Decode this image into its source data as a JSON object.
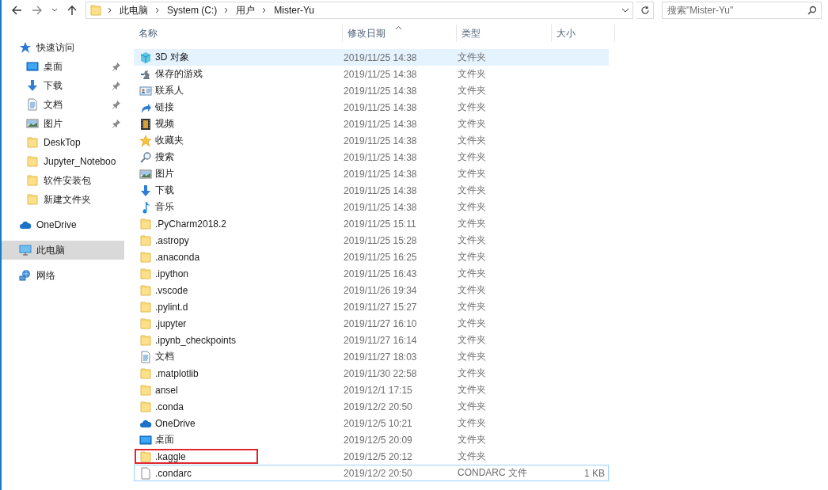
{
  "address": {
    "crumbs": [
      "此电脑",
      "System (C:)",
      "用户",
      "Mister-Yu"
    ]
  },
  "search": {
    "placeholder": "搜索\"Mister-Yu\""
  },
  "sidebar": {
    "items": [
      {
        "label": "快速访问",
        "kind": "star",
        "selected": false,
        "children": [
          {
            "label": "桌面",
            "kind": "desktop",
            "pinned": true,
            "selected": false
          },
          {
            "label": "下载",
            "kind": "downloads",
            "pinned": true,
            "selected": false
          },
          {
            "label": "文档",
            "kind": "document",
            "pinned": true,
            "selected": false
          },
          {
            "label": "图片",
            "kind": "pictures",
            "pinned": true,
            "selected": false
          },
          {
            "label": "DeskTop",
            "kind": "folder",
            "pinned": false,
            "selected": false
          },
          {
            "label": "Jupyter_Noteboo",
            "kind": "folder",
            "pinned": false,
            "selected": false
          },
          {
            "label": "软件安装包",
            "kind": "folder",
            "pinned": false,
            "selected": false
          },
          {
            "label": "新建文件夹",
            "kind": "folder",
            "pinned": false,
            "selected": false
          }
        ]
      },
      {
        "label": "OneDrive",
        "kind": "onedrive",
        "selected": false
      },
      {
        "label": "此电脑",
        "kind": "pc",
        "selected": true
      },
      {
        "label": "网络",
        "kind": "network",
        "selected": false
      }
    ]
  },
  "table": {
    "columns": [
      {
        "label": "名称",
        "sorted": false
      },
      {
        "label": "修改日期",
        "sorted": true
      },
      {
        "label": "类型",
        "sorted": false
      },
      {
        "label": "大小",
        "sorted": false
      }
    ],
    "rows": [
      {
        "name": "3D 对象",
        "date": "2019/11/25 14:38",
        "type": "文件夹",
        "kind": "cube",
        "hovered": true,
        "focused": false,
        "highlighted": false
      },
      {
        "name": "保存的游戏",
        "date": "2019/11/25 14:38",
        "type": "文件夹",
        "kind": "games",
        "hovered": false,
        "focused": false,
        "highlighted": false
      },
      {
        "name": "联系人",
        "date": "2019/11/25 14:38",
        "type": "文件夹",
        "kind": "contacts",
        "hovered": false,
        "focused": false,
        "highlighted": false
      },
      {
        "name": "链接",
        "date": "2019/11/25 14:38",
        "type": "文件夹",
        "kind": "link",
        "hovered": false,
        "focused": false,
        "highlighted": false
      },
      {
        "name": "视频",
        "date": "2019/11/25 14:38",
        "type": "文件夹",
        "kind": "video",
        "hovered": false,
        "focused": false,
        "highlighted": false
      },
      {
        "name": "收藏夹",
        "date": "2019/11/25 14:38",
        "type": "文件夹",
        "kind": "favorites",
        "hovered": false,
        "focused": false,
        "highlighted": false
      },
      {
        "name": "搜索",
        "date": "2019/11/25 14:38",
        "type": "文件夹",
        "kind": "search",
        "hovered": false,
        "focused": false,
        "highlighted": false
      },
      {
        "name": "图片",
        "date": "2019/11/25 14:38",
        "type": "文件夹",
        "kind": "pictures",
        "hovered": false,
        "focused": false,
        "highlighted": false
      },
      {
        "name": "下载",
        "date": "2019/11/25 14:38",
        "type": "文件夹",
        "kind": "downloads",
        "hovered": false,
        "focused": false,
        "highlighted": false
      },
      {
        "name": "音乐",
        "date": "2019/11/25 14:38",
        "type": "文件夹",
        "kind": "music",
        "hovered": false,
        "focused": false,
        "highlighted": false
      },
      {
        "name": ".PyCharm2018.2",
        "date": "2019/11/25 15:11",
        "type": "文件夹",
        "kind": "folder",
        "hovered": false,
        "focused": false,
        "highlighted": false
      },
      {
        "name": ".astropy",
        "date": "2019/11/25 15:28",
        "type": "文件夹",
        "kind": "folder",
        "hovered": false,
        "focused": false,
        "highlighted": false
      },
      {
        "name": ".anaconda",
        "date": "2019/11/25 16:25",
        "type": "文件夹",
        "kind": "folder",
        "hovered": false,
        "focused": false,
        "highlighted": false
      },
      {
        "name": ".ipython",
        "date": "2019/11/25 16:43",
        "type": "文件夹",
        "kind": "folder",
        "hovered": false,
        "focused": false,
        "highlighted": false
      },
      {
        "name": ".vscode",
        "date": "2019/11/26 19:34",
        "type": "文件夹",
        "kind": "folder",
        "hovered": false,
        "focused": false,
        "highlighted": false
      },
      {
        "name": ".pylint.d",
        "date": "2019/11/27 15:27",
        "type": "文件夹",
        "kind": "folder",
        "hovered": false,
        "focused": false,
        "highlighted": false
      },
      {
        "name": ".jupyter",
        "date": "2019/11/27 16:10",
        "type": "文件夹",
        "kind": "folder",
        "hovered": false,
        "focused": false,
        "highlighted": false
      },
      {
        "name": ".ipynb_checkpoints",
        "date": "2019/11/27 16:14",
        "type": "文件夹",
        "kind": "folder",
        "hovered": false,
        "focused": false,
        "highlighted": false
      },
      {
        "name": "文档",
        "date": "2019/11/27 18:03",
        "type": "文件夹",
        "kind": "document",
        "hovered": false,
        "focused": false,
        "highlighted": false
      },
      {
        "name": ".matplotlib",
        "date": "2019/11/30 22:58",
        "type": "文件夹",
        "kind": "folder",
        "hovered": false,
        "focused": false,
        "highlighted": false
      },
      {
        "name": "ansel",
        "date": "2019/12/1 17:15",
        "type": "文件夹",
        "kind": "folder",
        "hovered": false,
        "focused": false,
        "highlighted": false
      },
      {
        "name": ".conda",
        "date": "2019/12/2 20:50",
        "type": "文件夹",
        "kind": "folder",
        "hovered": false,
        "focused": false,
        "highlighted": false
      },
      {
        "name": "OneDrive",
        "date": "2019/12/5 10:21",
        "type": "文件夹",
        "kind": "onedrive",
        "hovered": false,
        "focused": false,
        "highlighted": false
      },
      {
        "name": "桌面",
        "date": "2019/12/5 20:09",
        "type": "文件夹",
        "kind": "desktop",
        "hovered": false,
        "focused": false,
        "highlighted": false
      },
      {
        "name": ".kaggle",
        "date": "2019/12/5 20:12",
        "type": "文件夹",
        "kind": "folder",
        "hovered": false,
        "focused": false,
        "highlighted": true
      },
      {
        "name": ".condarc",
        "date": "2019/12/2 20:50",
        "type": "CONDARC 文件",
        "size": "1 KB",
        "kind": "file",
        "hovered": false,
        "focused": true,
        "highlighted": false
      }
    ]
  }
}
